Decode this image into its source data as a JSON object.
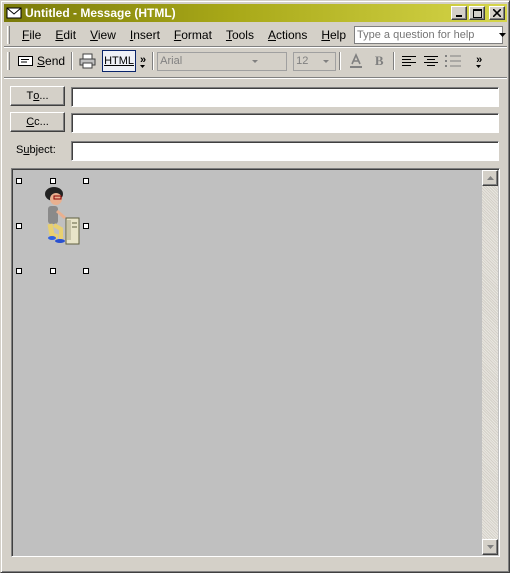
{
  "window": {
    "title": "Untitled - Message (HTML)",
    "title_bar_color": "#a8a818"
  },
  "menubar": {
    "items": [
      {
        "label": "File",
        "accel": "F",
        "rest": "ile"
      },
      {
        "label": "Edit",
        "accel": "E",
        "rest": "dit"
      },
      {
        "label": "View",
        "accel": "V",
        "rest": "iew"
      },
      {
        "label": "Insert",
        "accel": "I",
        "rest": "nsert"
      },
      {
        "label": "Format",
        "accel": "F",
        "rest": "ormat"
      },
      {
        "label": "Tools",
        "accel": "T",
        "rest": "ools"
      },
      {
        "label": "Actions",
        "accel": "A",
        "rest": "ctions"
      },
      {
        "label": "Help",
        "accel": "H",
        "rest": "elp"
      }
    ],
    "help_placeholder": "Type a question for help"
  },
  "toolbar": {
    "send_accel": "S",
    "send_rest": "end",
    "format_label": "HTML",
    "font_name": "Arial",
    "font_size": "12",
    "more": "»"
  },
  "address": {
    "to_accel": "o",
    "to_label_prefix": "T",
    "to_label_suffix": "...",
    "cc_accel": "C",
    "cc_label_suffix": "c...",
    "subject_accel": "u",
    "subject_prefix": "S",
    "subject_suffix": "bject:",
    "to_value": "",
    "cc_value": "",
    "subject_value": ""
  },
  "icons": {
    "title": "envelope-icon",
    "send": "send-icon",
    "print": "printer-icon",
    "font_color": "font-color-icon",
    "bold": "bold-icon",
    "align_left": "align-left-icon",
    "center": "center-icon",
    "bullets": "bullets-icon"
  },
  "body": {
    "background": "#c0c0c0",
    "image": "cartoon person at computer tower"
  }
}
